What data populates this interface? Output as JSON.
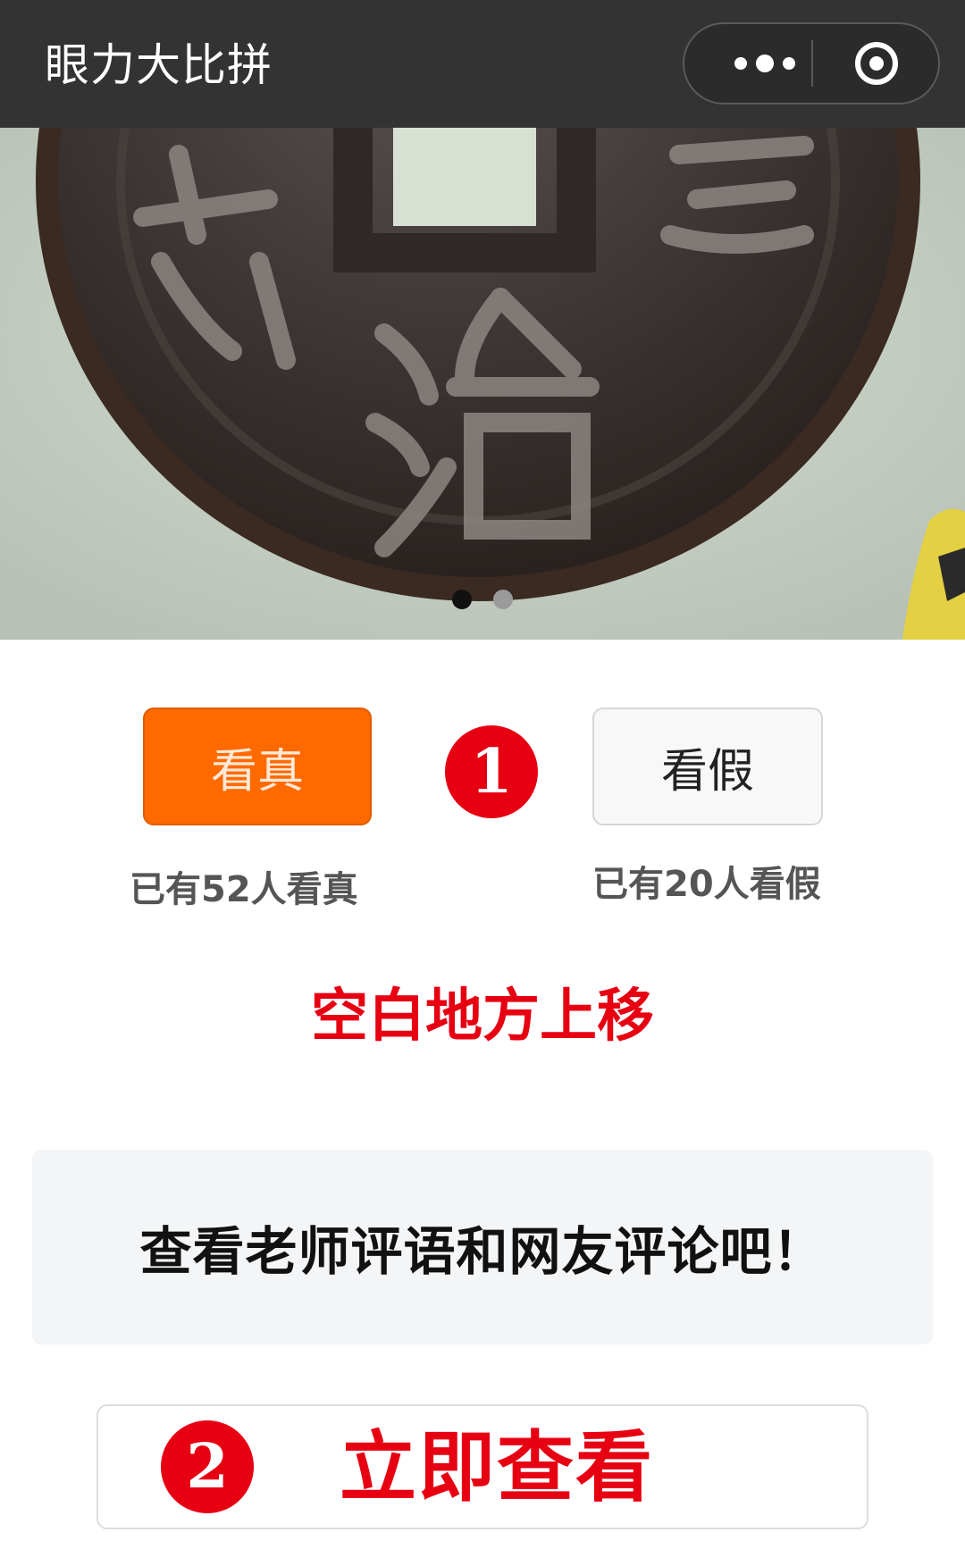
{
  "header": {
    "title": "眼力大比拼",
    "more_icon": "more-dots-icon",
    "close_icon": "target-circle-icon",
    "bg_color": "#333333"
  },
  "carousel": {
    "image": "coin-photo",
    "page_count": 2,
    "current_page": 1
  },
  "vote": {
    "true_label": "看真",
    "false_label": "看假",
    "true_count_text": "已有52人看真",
    "false_count_text": "已有20人看假",
    "accent_color": "#ff6a00"
  },
  "annotations": {
    "badge1": "1",
    "badge2": "2",
    "hint": "空白地方上移",
    "color": "#e60012"
  },
  "comments": {
    "prompt": "查看老师评语和网友评论吧！"
  },
  "view_button": {
    "label": "立即查看"
  }
}
